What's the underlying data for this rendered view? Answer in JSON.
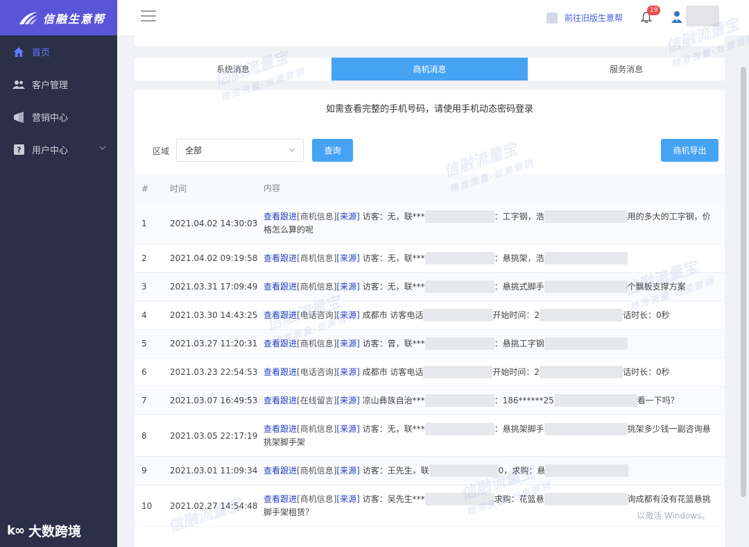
{
  "sidebar": {
    "logo_text": "信融生意帮",
    "items": [
      {
        "label": "首页",
        "icon": "home-icon",
        "active": true
      },
      {
        "label": "客户管理",
        "icon": "users-icon",
        "active": false
      },
      {
        "label": "营销中心",
        "icon": "megaphone-icon",
        "active": false
      },
      {
        "label": "用户中心",
        "icon": "help-icon",
        "active": false
      }
    ],
    "brand_mark": "k∞",
    "brand_text": "大数跨境"
  },
  "header": {
    "old_version_link": "前往旧版生意帮",
    "notification_count": "19"
  },
  "tabs": [
    "系统消息",
    "商机消息",
    "服务消息"
  ],
  "active_tab": 1,
  "notice": "如需查看完整的手机号码，请使用手机动态密码登录",
  "filter": {
    "label": "区域",
    "selected": "全部",
    "search_button": "查询",
    "export_button": "商机导出"
  },
  "table": {
    "columns": [
      "#",
      "时间",
      "内容"
    ],
    "rows": [
      {
        "idx": "1",
        "time": "2021.04.02 14:30:03",
        "link": "查看跟进",
        "tag": "[商机信息]",
        "src": "[来源]",
        "text1": "访客：无，联***",
        "text2": "：工字钢，浩",
        "text3": "用的多大的工字钢，价格怎么算的呢"
      },
      {
        "idx": "2",
        "time": "2021.04.02 09:19:58",
        "link": "查看跟进",
        "tag": "[商机信息]",
        "src": "[来源]",
        "text1": "访客：无，联***",
        "text2": "：悬挑架，浩",
        "text3": ""
      },
      {
        "idx": "3",
        "time": "2021.03.31 17:09:49",
        "link": "查看跟进",
        "tag": "[商机信息]",
        "src": "[来源]",
        "text1": "访客：无，联***",
        "text2": "：悬挑式脚手",
        "text3": "个飘板支撑方案"
      },
      {
        "idx": "4",
        "time": "2021.03.30 14:43:25",
        "link": "查看跟进",
        "tag": "[电话咨询]",
        "src": "[来源]",
        "text1": "成都市 访客电话",
        "text2": "开始时间：2",
        "text3": "话时长：0秒"
      },
      {
        "idx": "5",
        "time": "2021.03.27 11:20:31",
        "link": "查看跟进",
        "tag": "[商机信息]",
        "src": "[来源]",
        "text1": "访客：曾，联***",
        "text2": "：悬挑工字钢",
        "text3": ""
      },
      {
        "idx": "6",
        "time": "2021.03.23 22:54:53",
        "link": "查看跟进",
        "tag": "[电话咨询]",
        "src": "[来源]",
        "text1": "成都市 访客电话",
        "text2": "开始时间：2",
        "text3": "话时长：0秒"
      },
      {
        "idx": "7",
        "time": "2021.03.07 16:49:53",
        "link": "查看跟进",
        "tag": "[在线留言]",
        "src": "[来源]",
        "text1": "凉山彝族自治***",
        "text2": "：186******25",
        "text3": "看一下吗？"
      },
      {
        "idx": "8",
        "time": "2021.03.05 22:17:19",
        "link": "查看跟进",
        "tag": "[商机信息]",
        "src": "[来源]",
        "text1": "访客：无，联***",
        "text2": "：悬挑架脚手",
        "text3": "挑架多少钱一副咨询悬挑架脚手架"
      },
      {
        "idx": "9",
        "time": "2021.03.01 11:09:34",
        "link": "查看跟进",
        "tag": "[商机信息]",
        "src": "[来源]",
        "text1": "访客：王先生，联",
        "text2": "0，求购：悬",
        "text3": ""
      },
      {
        "idx": "10",
        "time": "2021.02.27 14:54:48",
        "link": "查看跟进",
        "tag": "[商机信息]",
        "src": "[来源]",
        "text1": "访客：吴先生***",
        "text2": "求购：花篮悬",
        "text3": "询成都有没有花篮悬挑脚手架租赁？"
      }
    ]
  },
  "watermark": {
    "main": "信融流量宝",
    "sub": "精准流量·效果营销"
  },
  "os_notice": "以激活 Windows。"
}
